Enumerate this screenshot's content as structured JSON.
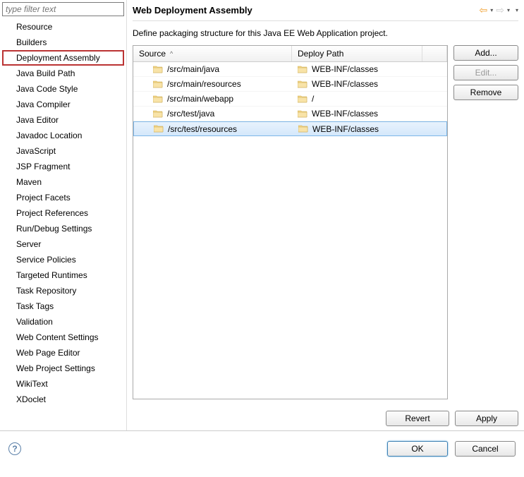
{
  "filter": {
    "placeholder": "type filter text"
  },
  "tree": {
    "items": [
      {
        "label": "Resource"
      },
      {
        "label": "Builders"
      },
      {
        "label": "Deployment Assembly"
      },
      {
        "label": "Java Build Path"
      },
      {
        "label": "Java Code Style"
      },
      {
        "label": "Java Compiler"
      },
      {
        "label": "Java Editor"
      },
      {
        "label": "Javadoc Location"
      },
      {
        "label": "JavaScript"
      },
      {
        "label": "JSP Fragment"
      },
      {
        "label": "Maven"
      },
      {
        "label": "Project Facets"
      },
      {
        "label": "Project References"
      },
      {
        "label": "Run/Debug Settings"
      },
      {
        "label": "Server"
      },
      {
        "label": "Service Policies"
      },
      {
        "label": "Targeted Runtimes"
      },
      {
        "label": "Task Repository"
      },
      {
        "label": "Task Tags"
      },
      {
        "label": "Validation"
      },
      {
        "label": "Web Content Settings"
      },
      {
        "label": "Web Page Editor"
      },
      {
        "label": "Web Project Settings"
      },
      {
        "label": "WikiText"
      },
      {
        "label": "XDoclet"
      }
    ],
    "highlighted_index": 2
  },
  "header": {
    "title": "Web Deployment Assembly"
  },
  "description": "Define packaging structure for this Java EE Web Application project.",
  "table": {
    "columns": {
      "source": "Source",
      "deploy": "Deploy Path"
    },
    "rows": [
      {
        "source": "/src/main/java",
        "deploy": "WEB-INF/classes"
      },
      {
        "source": "/src/main/resources",
        "deploy": "WEB-INF/classes"
      },
      {
        "source": "/src/main/webapp",
        "deploy": "/"
      },
      {
        "source": "/src/test/java",
        "deploy": "WEB-INF/classes"
      },
      {
        "source": "/src/test/resources",
        "deploy": "WEB-INF/classes"
      }
    ],
    "selected_index": 4
  },
  "side_buttons": {
    "add": "Add...",
    "edit": "Edit...",
    "remove": "Remove"
  },
  "bottom_buttons": {
    "revert": "Revert",
    "apply": "Apply"
  },
  "footer_buttons": {
    "ok": "OK",
    "cancel": "Cancel"
  }
}
